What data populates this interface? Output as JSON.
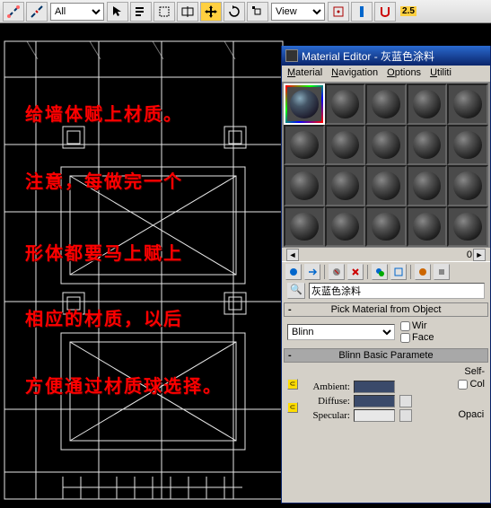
{
  "toolbar": {
    "filter_dropdown": "All",
    "view_dropdown": "View",
    "snap_badge": "2.5"
  },
  "annotations": {
    "line1": "给墙体赋上材质。",
    "line2": "注意，每做完一个",
    "line3": "形体都要马上赋上",
    "line4": "相应的材质，以后",
    "line5": "方便通过材质球选择。"
  },
  "material_editor": {
    "window_title": "Material Editor - 灰蓝色涂料",
    "menu": {
      "material": "Material",
      "navigation": "Navigation",
      "options": "Options",
      "utilities": "Utiliti"
    },
    "indicator": "0",
    "dropper_label": "🔍",
    "material_name": "灰蓝色涂料",
    "pick_button": "Pick Material from Object",
    "shader_panel": {
      "header_toggle": "-"
    },
    "shader_type": "Blinn",
    "wire_label": "Wir",
    "face_label": "Face",
    "blinn_panel": {
      "header": "Blinn Basic Paramete",
      "header_toggle": "-"
    },
    "self_label": "Self-",
    "color_checkbox_label": "Col",
    "ambient_label": "Ambient:",
    "diffuse_label": "Diffuse:",
    "specular_label": "Specular:",
    "opacity_label": "Opaci",
    "colors": {
      "ambient": "#3a4a6a",
      "diffuse": "#3a4a6a",
      "specular": "#e8e8e8"
    }
  }
}
